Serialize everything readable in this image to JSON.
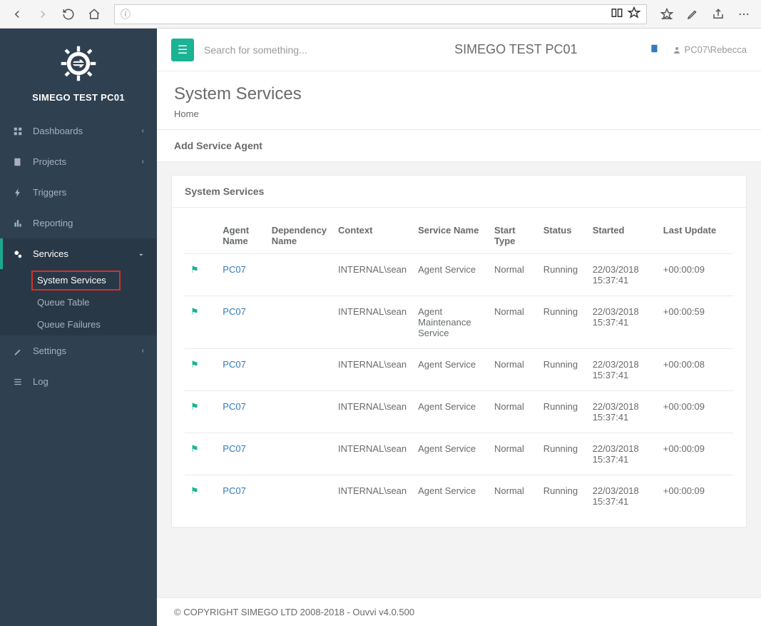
{
  "sidebar": {
    "title": "SIMEGO TEST PC01",
    "items": [
      {
        "label": "Dashboards"
      },
      {
        "label": "Projects"
      },
      {
        "label": "Triggers"
      },
      {
        "label": "Reporting"
      },
      {
        "label": "Services",
        "sub": [
          {
            "label": "System Services"
          },
          {
            "label": "Queue Table"
          },
          {
            "label": "Queue Failures"
          }
        ]
      },
      {
        "label": "Settings"
      },
      {
        "label": "Log"
      }
    ]
  },
  "topbar": {
    "search_placeholder": "Search for something...",
    "title": "SIMEGO TEST PC01",
    "user": "PC07\\Rebecca"
  },
  "page": {
    "title": "System Services",
    "breadcrumb": "Home",
    "action": "Add Service Agent",
    "panel_title": "System Services"
  },
  "table": {
    "headers": [
      "",
      "Agent Name",
      "Dependency Name",
      "Context",
      "Service Name",
      "Start Type",
      "Status",
      "Started",
      "Last Update"
    ],
    "rows": [
      {
        "agent": "PC07",
        "dep": "",
        "context": "INTERNAL\\sean",
        "service": "Agent Service",
        "start": "Normal",
        "status": "Running",
        "started": "22/03/2018 15:37:41",
        "updated": "+00:00:09"
      },
      {
        "agent": "PC07",
        "dep": "",
        "context": "INTERNAL\\sean",
        "service": "Agent Maintenance Service",
        "start": "Normal",
        "status": "Running",
        "started": "22/03/2018 15:37:41",
        "updated": "+00:00:59"
      },
      {
        "agent": "PC07",
        "dep": "",
        "context": "INTERNAL\\sean",
        "service": "Agent Service",
        "start": "Normal",
        "status": "Running",
        "started": "22/03/2018 15:37:41",
        "updated": "+00:00:08"
      },
      {
        "agent": "PC07",
        "dep": "",
        "context": "INTERNAL\\sean",
        "service": "Agent Service",
        "start": "Normal",
        "status": "Running",
        "started": "22/03/2018 15:37:41",
        "updated": "+00:00:09"
      },
      {
        "agent": "PC07",
        "dep": "",
        "context": "INTERNAL\\sean",
        "service": "Agent Service",
        "start": "Normal",
        "status": "Running",
        "started": "22/03/2018 15:37:41",
        "updated": "+00:00:09"
      },
      {
        "agent": "PC07",
        "dep": "",
        "context": "INTERNAL\\sean",
        "service": "Agent Service",
        "start": "Normal",
        "status": "Running",
        "started": "22/03/2018 15:37:41",
        "updated": "+00:00:09"
      }
    ]
  },
  "footer": "© COPYRIGHT SIMEGO LTD 2008-2018 - Ouvvi v4.0.500"
}
